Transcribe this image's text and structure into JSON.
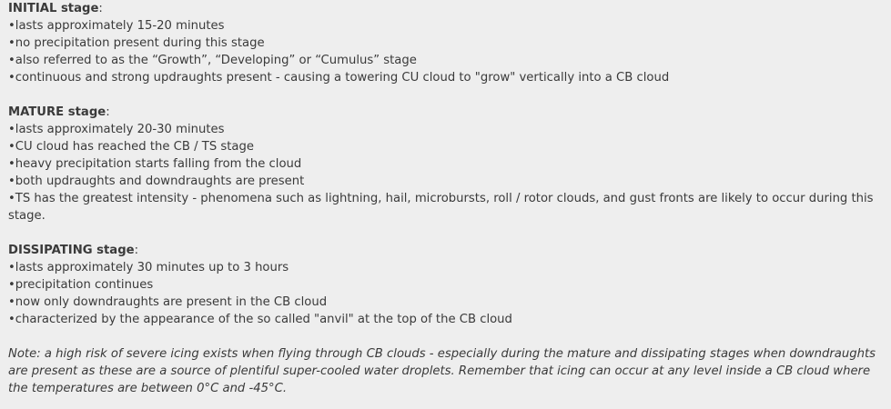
{
  "sections": [
    {
      "title": "INITIAL stage",
      "colon": ":",
      "items": [
        "lasts approximately 15-20 minutes",
        "no precipitation present during this stage",
        "also referred to as the “Growth”, “Developing” or “Cumulus” stage",
        "continuous and strong updraughts present - causing a towering CU cloud to \"grow\" vertically into a CB cloud"
      ]
    },
    {
      "title": "MATURE stage",
      "colon": ":",
      "items": [
        "lasts approximately 20-30 minutes",
        "CU cloud has reached the CB / TS stage",
        "heavy precipitation starts falling from the cloud",
        "both updraughts and downdraughts are present",
        "TS has the greatest intensity - phenomena such as lightning, hail, microbursts, roll / rotor clouds, and gust fronts are likely to occur during this stage."
      ]
    },
    {
      "title": "DISSIPATING stage",
      "colon": ":",
      "items": [
        "lasts approximately 30 minutes up to 3 hours",
        "precipitation continues",
        "now only downdraughts are present in the CB cloud",
        "characterized by the appearance of the so called \"anvil\" at the top of the CB cloud"
      ]
    }
  ],
  "note": "Note: a high risk of severe icing exists when flying through CB clouds - especially during the mature and dissipating stages when downdraughts are present as these are a source of plentiful super-cooled water droplets. Remember that icing can occur at any level inside a CB cloud where the temperatures are between 0°C and -45°C."
}
